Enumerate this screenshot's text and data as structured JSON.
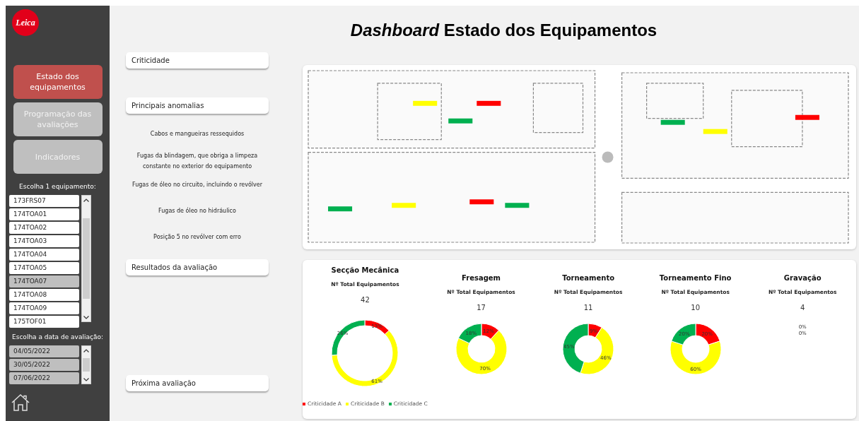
{
  "sidebar": {
    "logo": "Leica",
    "nav": [
      {
        "label": "Estado dos equipamentos",
        "selected": true
      },
      {
        "label": "Programação das avaliações",
        "selected": false
      },
      {
        "label": "Indicadores",
        "selected": false
      }
    ],
    "equipment_filter": {
      "label": "Escolha 1 equipamento:",
      "items": [
        {
          "label": "173FRS07",
          "selected": false
        },
        {
          "label": "174TOA01",
          "selected": false
        },
        {
          "label": "174TOA02",
          "selected": false
        },
        {
          "label": "174TOA03",
          "selected": false
        },
        {
          "label": "174TOA04",
          "selected": false
        },
        {
          "label": "174TOA05",
          "selected": false
        },
        {
          "label": "174TOA07",
          "selected": true
        },
        {
          "label": "174TOA08",
          "selected": false
        },
        {
          "label": "174TOA09",
          "selected": false
        },
        {
          "label": "175TOF01",
          "selected": false
        }
      ]
    },
    "date_filter": {
      "label": "Escolha a data de avaliação:",
      "items": [
        {
          "label": "04/05/2022",
          "selected": true
        },
        {
          "label": "30/05/2022",
          "selected": true
        },
        {
          "label": "07/06/2022",
          "selected": true
        }
      ]
    }
  },
  "title": "*Dashboard* Estado dos Equipamentos",
  "sections": [
    {
      "kind": "header",
      "label": "Criticidade"
    },
    {
      "kind": "header",
      "label": "Principais anomalias"
    },
    {
      "kind": "list",
      "items": [
        "Cabos e mangueiras ressequidos",
        "Fugas da blindagem, que obriga a limpeza constante no exterior do equipamento",
        "Fugas de óleo no circuito, incluindo o revólver",
        "Fugas de óleo no hidráulico",
        "Posição 5 no revólver com erro"
      ]
    },
    {
      "kind": "header",
      "label": "Resultados da avaliação"
    },
    {
      "kind": "header",
      "label": "Próxima avaliação"
    }
  ],
  "charts": [
    {
      "title": "Secção Mecânica",
      "subtitle": "Nº Total Equipamentos",
      "count": "42",
      "chart_data": {
        "type": "donut",
        "categories": [
          "Criticidade A",
          "Criticidade B",
          "Criticidade C"
        ],
        "series": [
          {
            "values": [
              13,
              61,
              26
            ]
          }
        ],
        "colors": [
          "#ff0000",
          "#ffff00",
          "#00b050"
        ],
        "value_labels": [
          "13%",
          "61%",
          "26%"
        ]
      }
    },
    {
      "title": "Fresagem",
      "subtitle": "Nº Total Equipamentos",
      "count": "17",
      "chart_data": {
        "type": "donut",
        "series": [
          {
            "values": [
              12,
              70,
              18
            ]
          }
        ],
        "colors": [
          "#ff0000",
          "#ffff00",
          "#00b050"
        ],
        "value_labels": [
          "12%",
          "70%",
          "18%"
        ]
      }
    },
    {
      "title": "Torneamento",
      "subtitle": "Nº Total Equipamentos",
      "count": "11",
      "chart_data": {
        "type": "donut",
        "series": [
          {
            "values": [
              9,
              46,
              45
            ]
          }
        ],
        "colors": [
          "#ff0000",
          "#ffff00",
          "#00b050"
        ],
        "value_labels": [
          "9%",
          "46%",
          "45%"
        ]
      }
    },
    {
      "title": "Torneamento Fino",
      "subtitle": "Nº Total Equipamentos",
      "count": "10",
      "chart_data": {
        "type": "donut",
        "series": [
          {
            "values": [
              20,
              60,
              20
            ]
          }
        ],
        "colors": [
          "#ff0000",
          "#ffff00",
          "#00b050"
        ],
        "value_labels": [
          "20%",
          "60%",
          "20%"
        ]
      }
    },
    {
      "title": "Gravação",
      "subtitle": "Nº Total Equipamentos",
      "count": "4",
      "empty_labels": [
        "0%",
        "0%"
      ]
    }
  ]
}
